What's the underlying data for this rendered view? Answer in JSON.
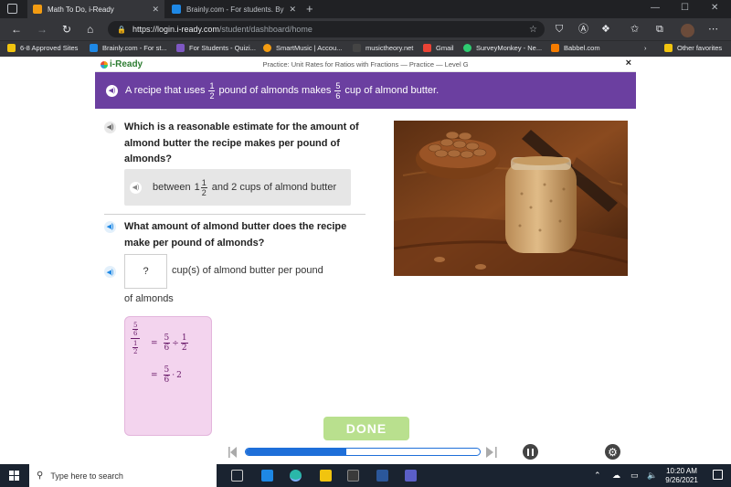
{
  "browser": {
    "tabs": [
      {
        "title": "Math To Do, i-Ready",
        "active": true,
        "favicon_color": "#f39c12"
      },
      {
        "title": "Brainly.com - For students. By stu",
        "active": false,
        "favicon_color": "#1e88e5"
      }
    ],
    "new_tab": "+",
    "url_host": "https://login.i-ready.com",
    "url_path": "/student/dashboard/home",
    "bookmarks": [
      {
        "label": "6-8 Approved Sites",
        "icon_color": "#f1c40f"
      },
      {
        "label": "Brainly.com - For st...",
        "icon_color": "#1e88e5"
      },
      {
        "label": "For Students - Quizi...",
        "icon_color": "#7e57c2"
      },
      {
        "label": "SmartMusic | Accou...",
        "icon_color": "#f39c12"
      },
      {
        "label": "musictheory.net",
        "icon_color": "#444444"
      },
      {
        "label": "Gmail",
        "icon_color": "#ea4335"
      },
      {
        "label": "SurveyMonkey - Ne...",
        "icon_color": "#2ecc71"
      },
      {
        "label": "Babbel.com",
        "icon_color": "#f57c00"
      }
    ],
    "other_favorites": "Other favorites"
  },
  "iready": {
    "logo": "i-Ready",
    "header_title": "Practice: Unit Rates for Ratios with Fractions — Practice — Level G",
    "close": "×",
    "banner": {
      "text_a": "A recipe that uses",
      "frac1_num": "1",
      "frac1_den": "2",
      "text_b": "pound of almonds makes",
      "frac2_num": "5",
      "frac2_den": "6",
      "text_c": "cup of almond butter."
    },
    "question1": "Which is a reasonable estimate for the amount of almond butter the recipe makes per pound of almonds?",
    "answer1": {
      "prefix": "between",
      "whole": "1",
      "num": "1",
      "den": "2",
      "suffix": "and 2 cups of almond butter"
    },
    "question2": "What amount of almond butter does the recipe make per pound of almonds?",
    "answer_box": "?",
    "answer_suffix": "cup(s) of almond butter per pound",
    "answer_suffix2": "of almonds",
    "scratch": {
      "outer_num_num": "5",
      "outer_num_den": "6",
      "outer_den_num": "1",
      "outer_den_den": "2",
      "eq": "=",
      "l1_a_num": "5",
      "l1_a_den": "6",
      "l1_op": "÷",
      "l1_b_num": "1",
      "l1_b_den": "2",
      "l2_num": "5",
      "l2_den": "6",
      "l2_op": "·",
      "l2_b": "2"
    },
    "done": "DONE",
    "progress": 0.43,
    "accent": "#6b3fa0"
  },
  "taskbar": {
    "search_placeholder": "Type here to search",
    "time": "10:20 AM",
    "date": "9/26/2021"
  }
}
